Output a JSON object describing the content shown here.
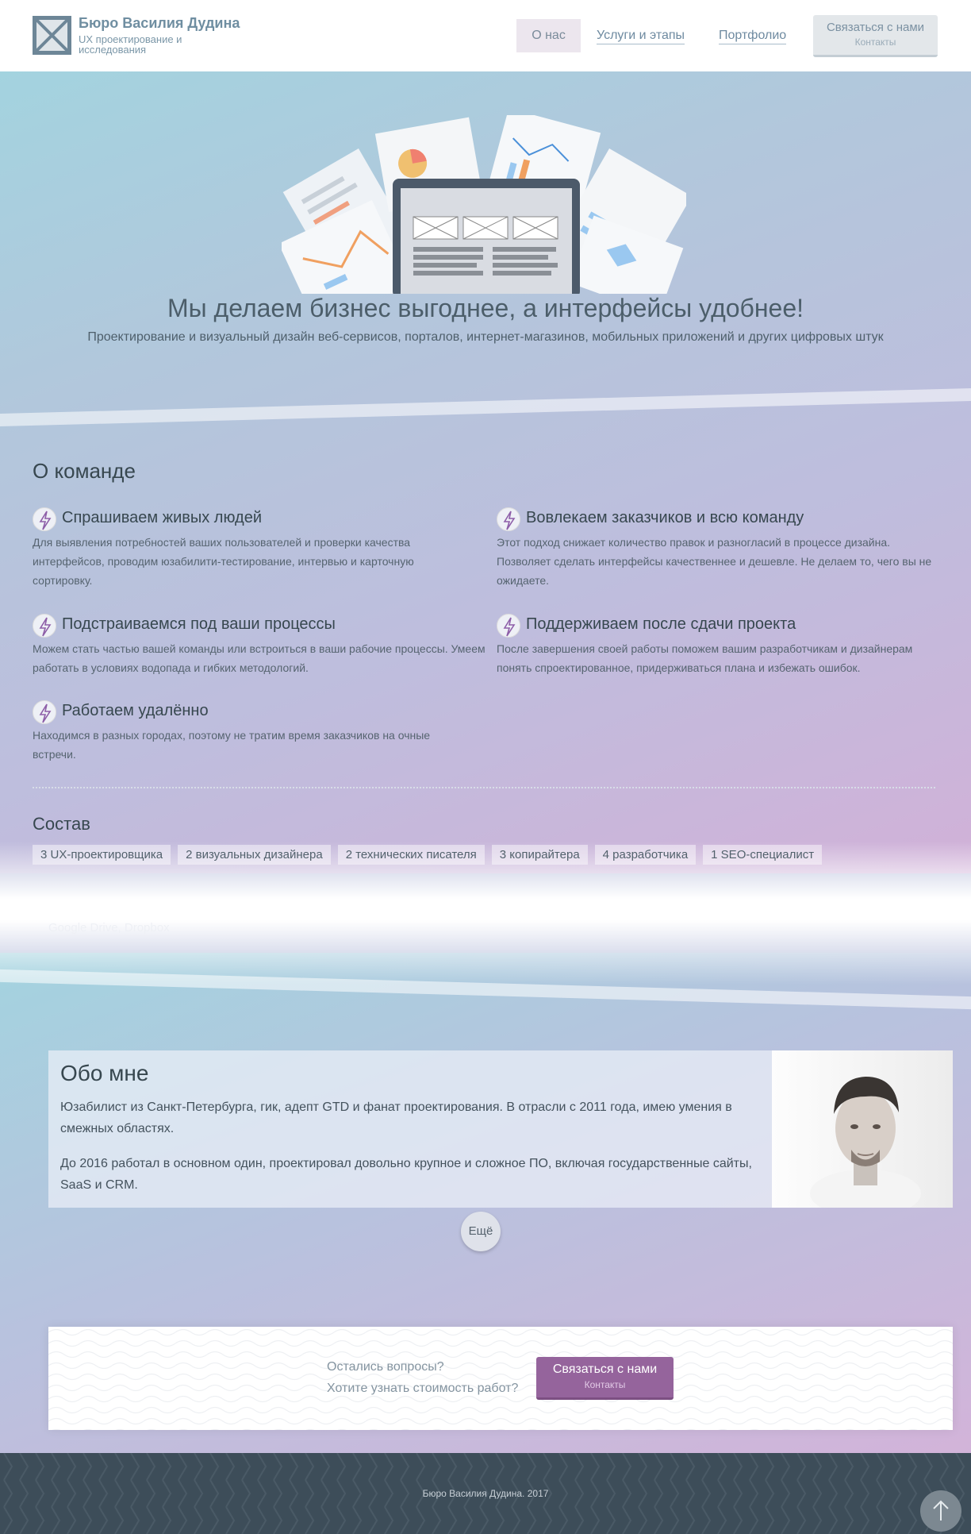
{
  "header": {
    "brand_name": "Бюро Василия Дудина",
    "brand_sub": "UX проектирование и исследования",
    "logo_icon": "logo-crossed-box-icon",
    "nav": [
      {
        "label": "О нас",
        "active": true
      },
      {
        "label": "Услуги и этапы",
        "active": false
      },
      {
        "label": "Портфолио",
        "active": false
      }
    ],
    "contact_button": {
      "label": "Связаться с нами",
      "sub": "Контакты"
    }
  },
  "hero": {
    "title": "Мы делаем бизнес выгоднее, а интерфейсы удобнее!",
    "subtitle": "Проектирование и визуальный дизайн веб-сервисов, порталов, интернет-магазинов, мобильных приложений и других цифровых штук"
  },
  "team": {
    "title": "О команде",
    "feature_icon": "lightning-icon",
    "features": [
      {
        "title": "Спрашиваем живых людей",
        "text": "Для выявления потребностей ваших пользователей и проверки качества интерфейсов, проводим юзабилити-тестирование, интервью и карточную сортировку."
      },
      {
        "title": "Вовлекаем заказчиков и всю команду",
        "text": "Этот подход снижает количество правок и разногласий в процессе дизайна. Позволяет сделать интерфейсы качественнее и дешевле. Не делаем то, чего вы не ожидаете."
      },
      {
        "title": "Подстраиваемся под ваши процессы",
        "text": "Можем стать частью вашей команды или встроиться в ваши рабочие процессы. Умеем работать в условиях водопада и гибких методологий."
      },
      {
        "title": "Поддерживаем после сдачи проекта",
        "text": "После завершения своей работы поможем вашим разработчикам и дизайнерам понять спроектированное, придерживаться плана и избежать ошибок."
      },
      {
        "title": "Работаем удалённо",
        "text": "Находимся в разных городах, поэтому не тратим время заказчиков на очные встречи."
      }
    ],
    "composition_title": "Состав",
    "composition": [
      "3 UX-проектировщика",
      "2 визуальных дизайнера",
      "2 технических писателя",
      "3 копирайтера",
      "4 разработчика",
      "1 SEO-специалист"
    ],
    "faded_text": "Google Drive, Dropbox"
  },
  "about": {
    "title": "Обо мне",
    "p1": "Юзабилист из Санкт-Петербурга, гик, адепт GTD и фанат проектирования. В отрасли с 2011 года, имею умения в смежных областях.",
    "p2": "До 2016 работал в основном один, проектировал довольно крупное и сложное ПО, включая государственные сайты, SaaS и CRM.",
    "more_label": "Ещё"
  },
  "cta": {
    "q1": "Остались вопросы?",
    "q2": "Хотите узнать стоимость работ?",
    "button": {
      "label": "Связаться с нами",
      "sub": "Контакты"
    }
  },
  "footer": {
    "text": "Бюро Василия Дудина. 2017",
    "up_icon": "arrow-up-icon"
  }
}
